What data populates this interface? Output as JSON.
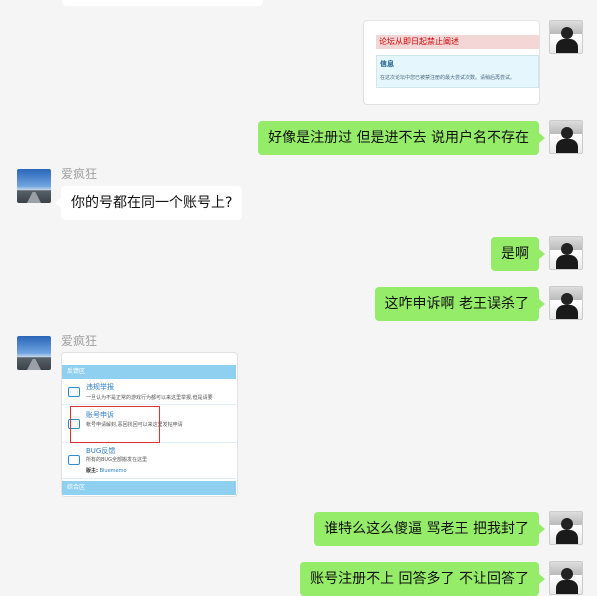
{
  "messages": {
    "img1": {
      "error_title": "论坛从即日起禁止阐述",
      "info_title": "信息",
      "info_text": "在这次论坛中您已被禁注册的最大尝试次数。请稍后再尝试。"
    },
    "msg1": "好像是注册过 但是进不去  说用户名不存在",
    "sender1": "爱疯狂",
    "msg2": "你的号都在同一个账号上?",
    "msg3": "是啊",
    "msg4": "这咋申诉啊   老王误杀了",
    "sender2": "爱疯狂",
    "img2": {
      "header": "反馈区",
      "rows": [
        {
          "title": "违规举报",
          "desc": "一旦认为不是正常的游戏行为都可以来这里举报,但是请要"
        },
        {
          "title": "账号申诉",
          "desc": "帐号申请解封,恶回找回可以来这里发帖申请"
        },
        {
          "title": "BUG反馈",
          "desc": "所有的BUG全部搬发在这里",
          "mod_label": "版主:",
          "mod_name": "Bluememo"
        }
      ],
      "footer": "综合区"
    },
    "msg5": "谁特么这么傻逼 骂老王  把我封了",
    "msg6": "账号注册不上  回答多了 不让回答了"
  }
}
